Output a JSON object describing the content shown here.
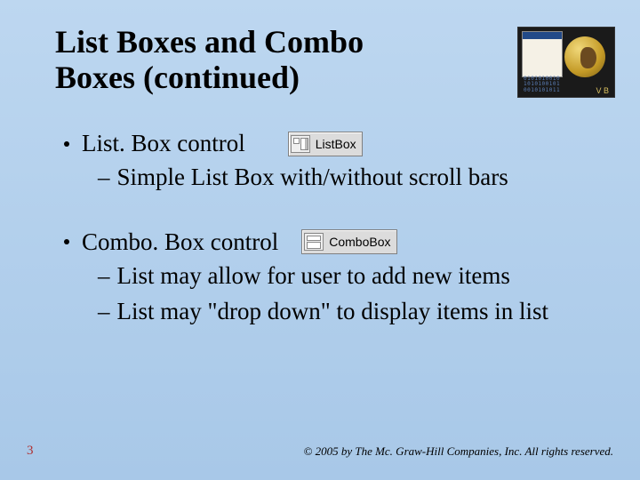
{
  "title": "List Boxes and Combo Boxes (continued)",
  "bullets": [
    {
      "text": "List. Box control",
      "toolbox_label": "ListBox",
      "sub": [
        "Simple List Box with/without scroll bars"
      ]
    },
    {
      "text": "Combo. Box control",
      "toolbox_label": "ComboBox",
      "sub": [
        "List may allow for user to add new items",
        "List may \"drop down\" to display items in list"
      ]
    }
  ],
  "page_number": "3",
  "copyright": "© 2005 by The Mc. Graw-Hill Companies, Inc. All rights reserved.",
  "decor": {
    "mini_label": "V B"
  }
}
